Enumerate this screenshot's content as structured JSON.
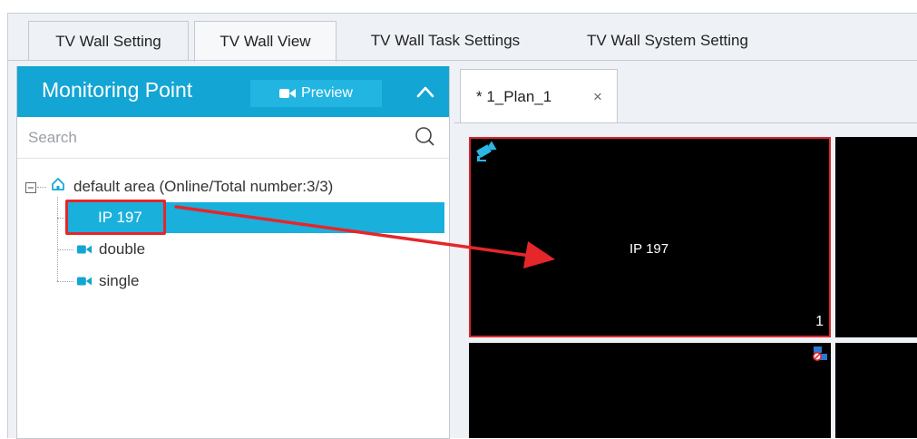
{
  "tabs": [
    {
      "label": "TV Wall Setting"
    },
    {
      "label": "TV Wall View",
      "active": true
    },
    {
      "label": "TV Wall Task Settings"
    },
    {
      "label": "TV Wall System Setting"
    }
  ],
  "left_panel": {
    "title": "Monitoring Point",
    "preview_label": "Preview",
    "search_placeholder": "Search",
    "tree": {
      "root_label": "default area (Online/Total number:3/3)",
      "items": [
        {
          "label": "IP 197",
          "selected": true
        },
        {
          "label": "double"
        },
        {
          "label": "single"
        }
      ]
    }
  },
  "plan_tab": {
    "label": "* 1_Plan_1",
    "close": "×"
  },
  "wall": {
    "cell1_label": "IP 197",
    "cell1_index": "1"
  },
  "colors": {
    "accent": "#13a5d4",
    "selected": "#1ab0dc",
    "highlight": "#e5262a",
    "wall_bg": "#000000"
  }
}
